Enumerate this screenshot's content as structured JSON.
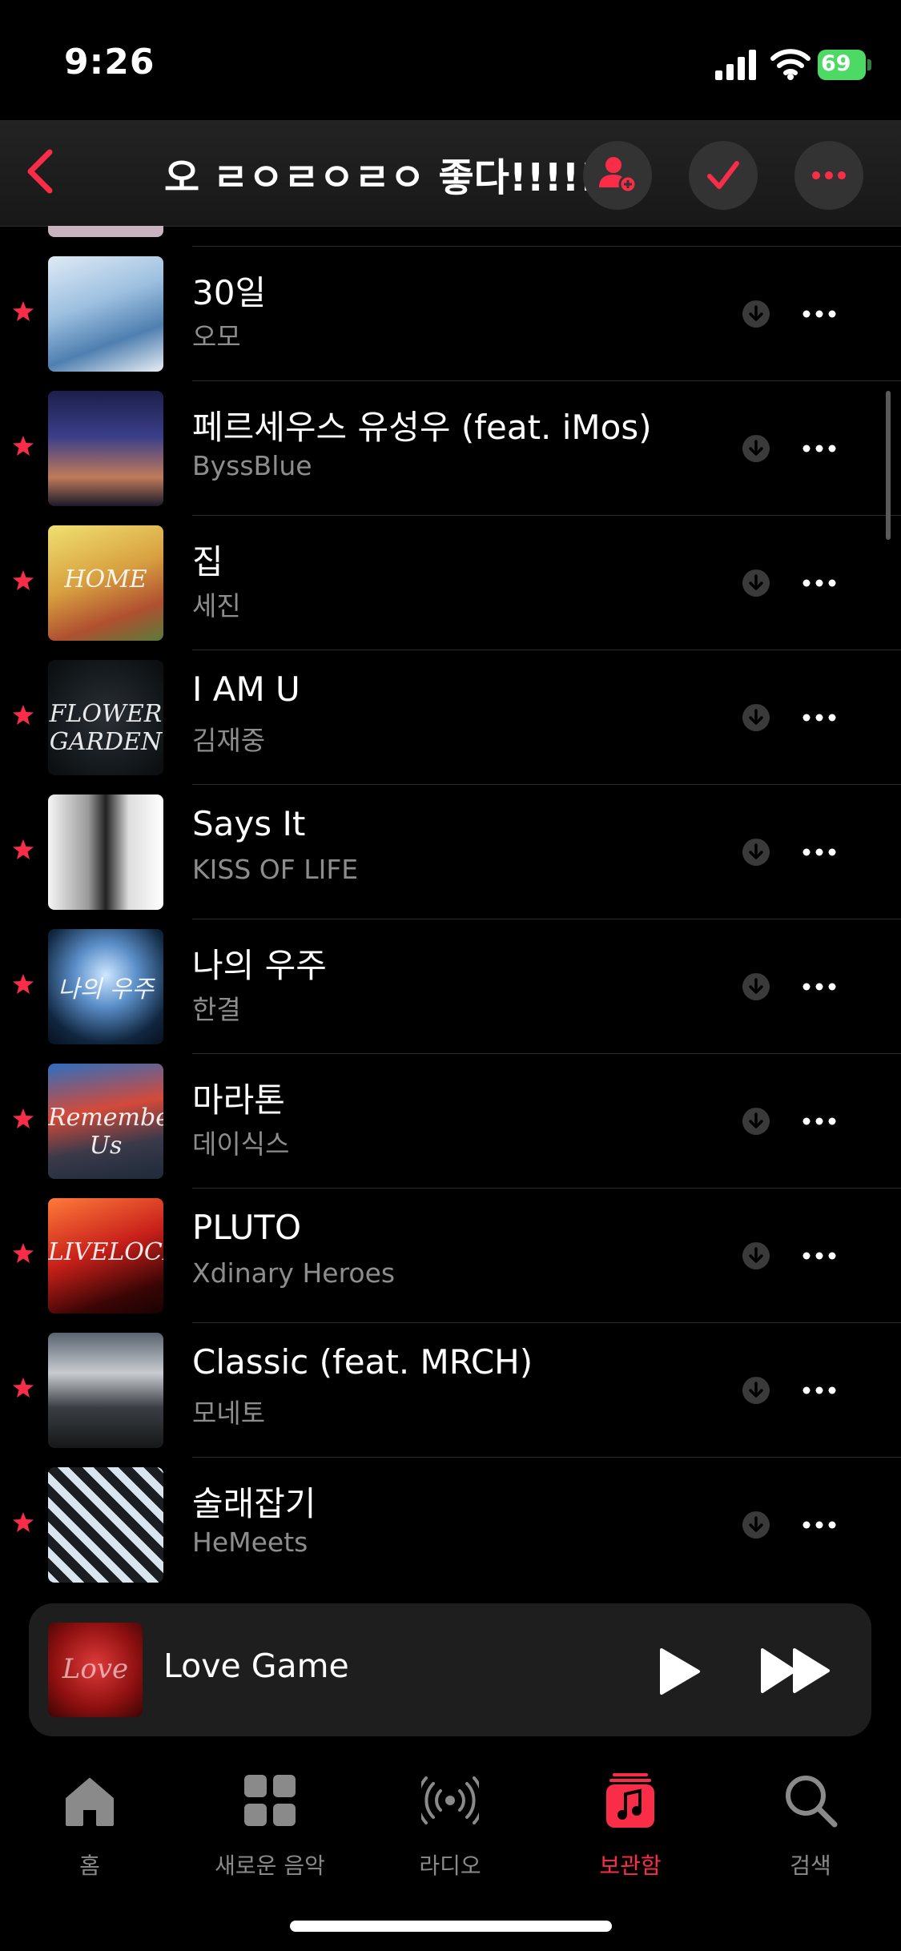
{
  "status_bar": {
    "time": "9:26",
    "battery": "69"
  },
  "header": {
    "title": "오 ㄹㅇㄹㅇㄹㅇ 좋다!!!!!"
  },
  "songs": [
    {
      "title": "30일",
      "artist": "오모"
    },
    {
      "title": "페르세우스 유성우 (feat. iMos)",
      "artist": "ByssBlue"
    },
    {
      "title": "집",
      "artist": "세진",
      "art_text": "HOME"
    },
    {
      "title": "I AM U",
      "artist": "김재중",
      "art_text": "FLOWER GARDEN"
    },
    {
      "title": "Says It",
      "artist": "KISS OF LIFE"
    },
    {
      "title": "나의 우주",
      "artist": "한결",
      "art_text": "나의 우주"
    },
    {
      "title": "마라톤",
      "artist": "데이식스",
      "art_text": "Remember Us"
    },
    {
      "title": "PLUTO",
      "artist": "Xdinary Heroes",
      "art_text": "LIVELOCK"
    },
    {
      "title": "Classic (feat. MRCH)",
      "artist": "모네토"
    },
    {
      "title": "술래잡기",
      "artist": "HeMeets"
    }
  ],
  "now_playing": {
    "title": "Love Game",
    "art_text": "Love"
  },
  "tabs": [
    {
      "label": "홈",
      "icon": "home-icon"
    },
    {
      "label": "새로운 음악",
      "icon": "grid-icon"
    },
    {
      "label": "라디오",
      "icon": "radio-icon"
    },
    {
      "label": "보관함",
      "icon": "library-icon",
      "active": true
    },
    {
      "label": "검색",
      "icon": "search-icon"
    }
  ],
  "colors": {
    "accent": "#fa2d48",
    "background": "#000000",
    "secondary_text": "#8d8d8d"
  }
}
